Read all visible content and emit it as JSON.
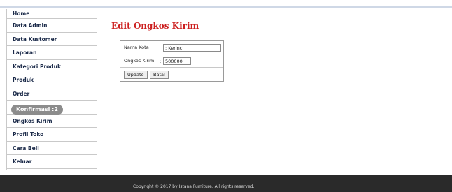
{
  "sidebar": {
    "items": [
      {
        "label": "Home"
      },
      {
        "label": "Data Admin"
      },
      {
        "label": "Data Kustomer"
      },
      {
        "label": "Laporan"
      },
      {
        "label": "Kategori Produk"
      },
      {
        "label": "Produk"
      },
      {
        "label": "Order"
      },
      {
        "label": "Konfirmasi :2"
      },
      {
        "label": "Ongkos Kirim"
      },
      {
        "label": "Profil Toko"
      },
      {
        "label": "Cara Beli"
      },
      {
        "label": "Keluar"
      }
    ]
  },
  "main": {
    "title": "Edit Ongkos Kirim",
    "form": {
      "kota_label": "Nama Kota",
      "kota_value": ": Kerinci",
      "ongkos_label": "Ongkos Kirim",
      "ongkos_colon": ":",
      "ongkos_value": "500000",
      "update_label": "Update",
      "batal_label": "Batal"
    }
  },
  "footer": {
    "text": "Copyright © 2017 by Istana Furniture. All rights reserved."
  },
  "colors": {
    "title": "#cc1f1f",
    "menu_text": "#1b2a49",
    "badge": "#8c8c8c",
    "footer_bg": "#2a2a2a"
  }
}
